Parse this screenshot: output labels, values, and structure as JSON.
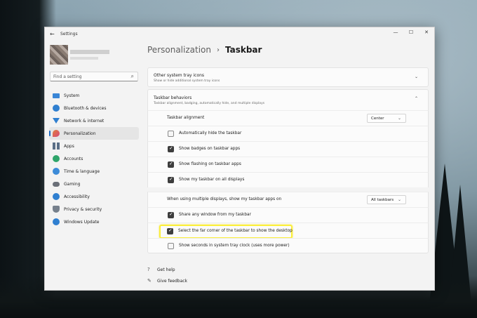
{
  "window": {
    "title": "Settings"
  },
  "window_controls": {
    "minimize": "—",
    "maximize": "☐",
    "close": "✕"
  },
  "sidebar": {
    "search": {
      "placeholder": "Find a setting"
    },
    "items": [
      {
        "label": "System",
        "icon": "system-icon"
      },
      {
        "label": "Bluetooth & devices",
        "icon": "bluetooth-icon"
      },
      {
        "label": "Network & internet",
        "icon": "network-icon"
      },
      {
        "label": "Personalization",
        "icon": "personalization-icon",
        "active": true
      },
      {
        "label": "Apps",
        "icon": "apps-icon"
      },
      {
        "label": "Accounts",
        "icon": "accounts-icon"
      },
      {
        "label": "Time & language",
        "icon": "time-language-icon"
      },
      {
        "label": "Gaming",
        "icon": "gaming-icon"
      },
      {
        "label": "Accessibility",
        "icon": "accessibility-icon"
      },
      {
        "label": "Privacy & security",
        "icon": "privacy-icon"
      },
      {
        "label": "Windows Update",
        "icon": "windows-update-icon"
      }
    ]
  },
  "breadcrumb": {
    "parent": "Personalization",
    "separator": "›",
    "current": "Taskbar"
  },
  "sections": {
    "tray_icons": {
      "title": "Other system tray icons",
      "subtitle": "Show or hide additional system tray icons"
    },
    "behaviors": {
      "title": "Taskbar behaviors",
      "subtitle": "Taskbar alignment, badging, automatically hide, and multiple displays"
    }
  },
  "behaviors": {
    "alignment": {
      "label": "Taskbar alignment",
      "value": "Center"
    },
    "auto_hide": {
      "label": "Automatically hide the taskbar",
      "checked": false
    },
    "badges": {
      "label": "Show badges on taskbar apps",
      "checked": true
    },
    "flashing": {
      "label": "Show flashing on taskbar apps",
      "checked": true
    },
    "all_displays": {
      "label": "Show my taskbar on all displays",
      "checked": true
    },
    "multi_display": {
      "label": "When using multiple displays, show my taskbar apps on",
      "value": "All taskbars"
    },
    "share_window": {
      "label": "Share any window from my taskbar",
      "checked": true
    },
    "far_corner": {
      "label": "Select the far corner of the taskbar to show the desktop",
      "checked": true
    },
    "seconds": {
      "label": "Show seconds in system tray clock (uses more power)",
      "checked": false
    }
  },
  "help": {
    "get_help": "Get help",
    "give_feedback": "Give feedback"
  },
  "colors": {
    "accent": "#1c6bc4",
    "highlight": "#fbef3a",
    "window_bg": "#f3f3f3"
  }
}
